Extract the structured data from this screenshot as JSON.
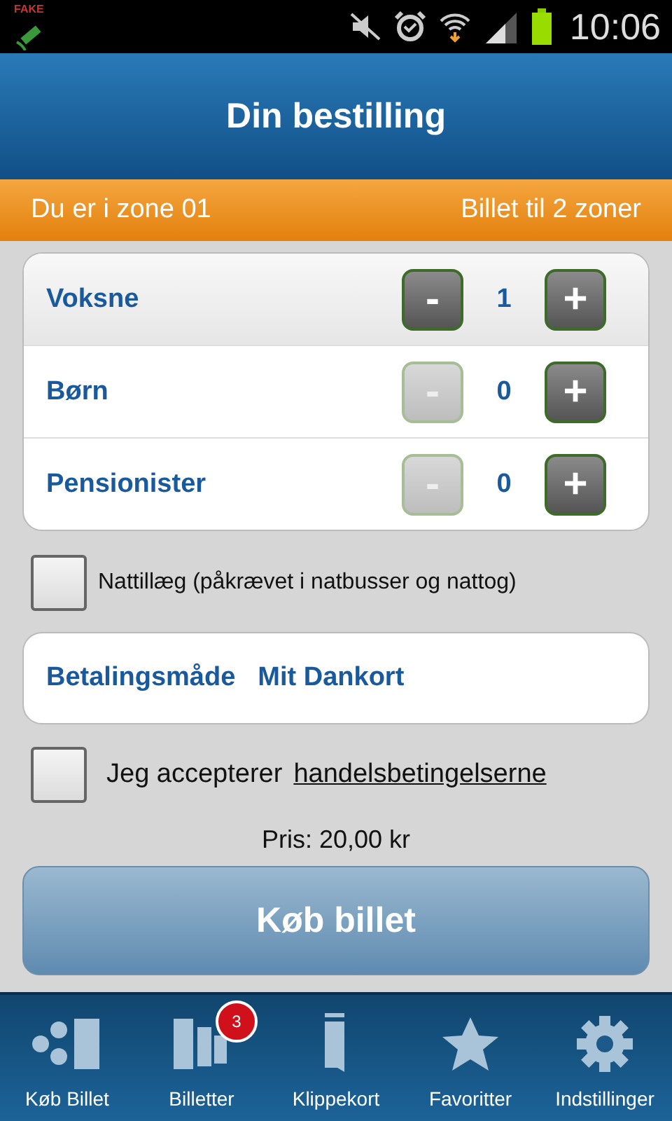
{
  "status_bar": {
    "app_icon_label": "FAKE",
    "time": "10:06"
  },
  "header": {
    "title": "Din bestilling"
  },
  "zone_bar": {
    "zone": "Du er i zone 01",
    "ticket": "Billet til 2 zoner"
  },
  "passengers": [
    {
      "label": "Voksne",
      "count": "1",
      "minus": "-",
      "plus": "+",
      "decrease_disabled": false,
      "highlighted": true
    },
    {
      "label": "Børn",
      "count": "0",
      "minus": "-",
      "plus": "+",
      "decrease_disabled": true,
      "highlighted": false
    },
    {
      "label": "Pensionister",
      "count": "0",
      "minus": "-",
      "plus": "+",
      "decrease_disabled": true,
      "highlighted": false
    }
  ],
  "night_supplement": {
    "label": "Nattillæg (påkrævet i natbusser og nattog)",
    "checked": false
  },
  "payment": {
    "label": "Betalingsmåde",
    "value": "Mit Dankort"
  },
  "terms": {
    "text": "Jeg accepterer",
    "link": "handelsbetingelserne",
    "checked": false
  },
  "price": "Pris: 20,00 kr",
  "buy_button": "Køb billet",
  "nav": [
    {
      "kind": "buy",
      "label": "Køb Billet",
      "selected": false
    },
    {
      "kind": "tickets",
      "label": "Billetter",
      "badge": "3",
      "selected": false
    },
    {
      "kind": "clip",
      "label": "Klippekort",
      "selected": false
    },
    {
      "kind": "star",
      "label": "Favoritter",
      "selected": false
    },
    {
      "kind": "gear",
      "label": "Indstillinger",
      "selected": false
    }
  ]
}
